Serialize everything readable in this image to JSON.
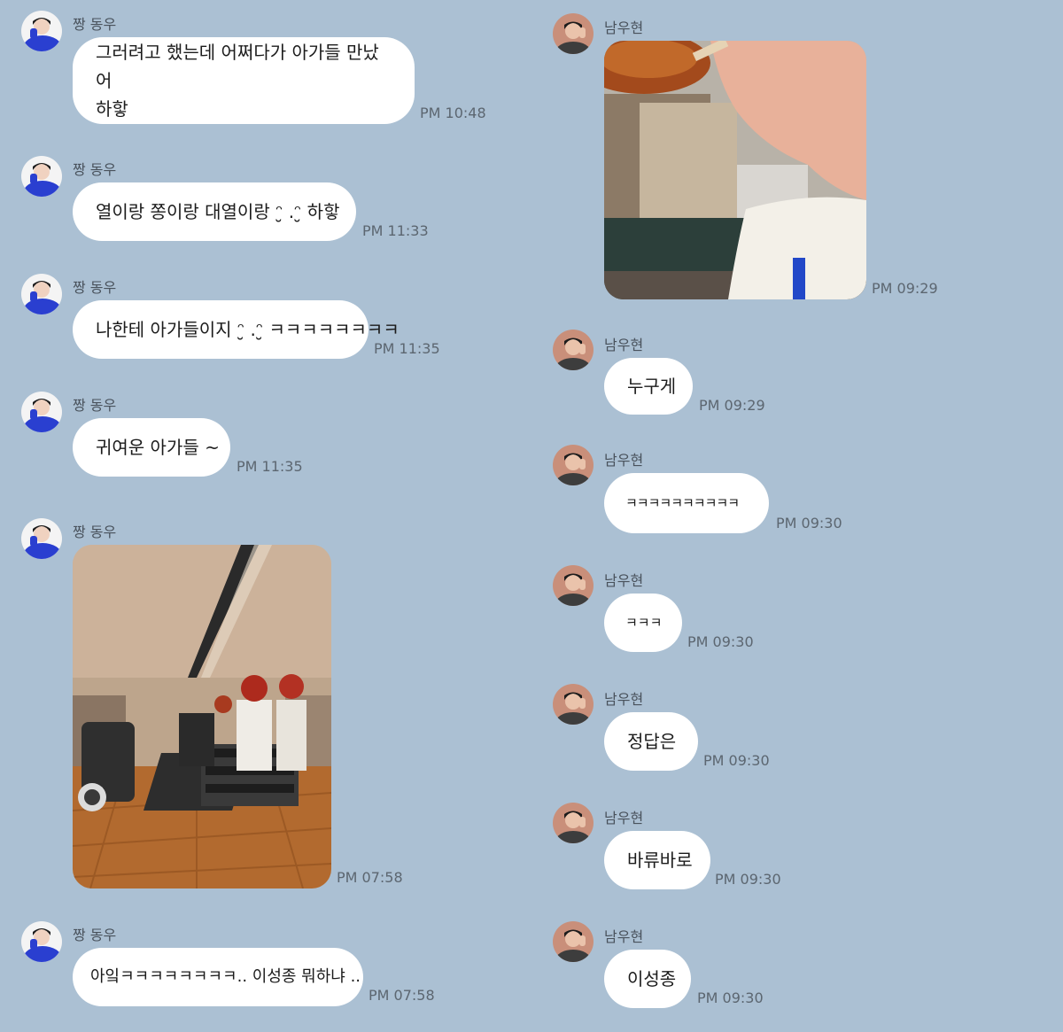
{
  "left": {
    "sender": "짱 동우",
    "messages": [
      {
        "text_line1": "그러려고 했는데 어쩌다가 아가들 만났어",
        "text_line2": "하핳",
        "time": "PM 10:48"
      },
      {
        "text": "열이랑 쫑이랑 대열이랑 ᵔ̮ .ᵔ̮  하핳",
        "time": "PM 11:33"
      },
      {
        "text": "나한테 아가들이지 ᵔ̮ .ᵔ̮ ㅋㅋㅋㅋㅋㅋㅋㅋ",
        "time": "PM 11:35"
      },
      {
        "text": "귀여운 아가들 ~",
        "time": "PM 11:35"
      },
      {
        "image": "gym-photo",
        "time": "PM 07:58"
      },
      {
        "text": "아잌ㅋㅋㅋㅋㅋㅋㅋㅋ..  이성종 뭐하냐 ..",
        "time": "PM 07:58"
      }
    ]
  },
  "right": {
    "sender": "남우현",
    "messages": [
      {
        "image": "food-closeup-photo",
        "time": "PM 09:29"
      },
      {
        "text": "누구게",
        "time": "PM 09:29"
      },
      {
        "text": "ㅋㅋㅋㅋㅋㅋㅋㅋㅋㅋ",
        "time": "PM 09:30"
      },
      {
        "text": "ㅋㅋㅋ",
        "time": "PM 09:30"
      },
      {
        "text": "정답은",
        "time": "PM 09:30"
      },
      {
        "text": "바류바로",
        "time": "PM 09:30"
      },
      {
        "text": "이성종",
        "time": "PM 09:30"
      }
    ]
  },
  "colors": {
    "background": "#abc0d3",
    "bubble": "#ffffff",
    "timestamp": "#5c6670"
  }
}
